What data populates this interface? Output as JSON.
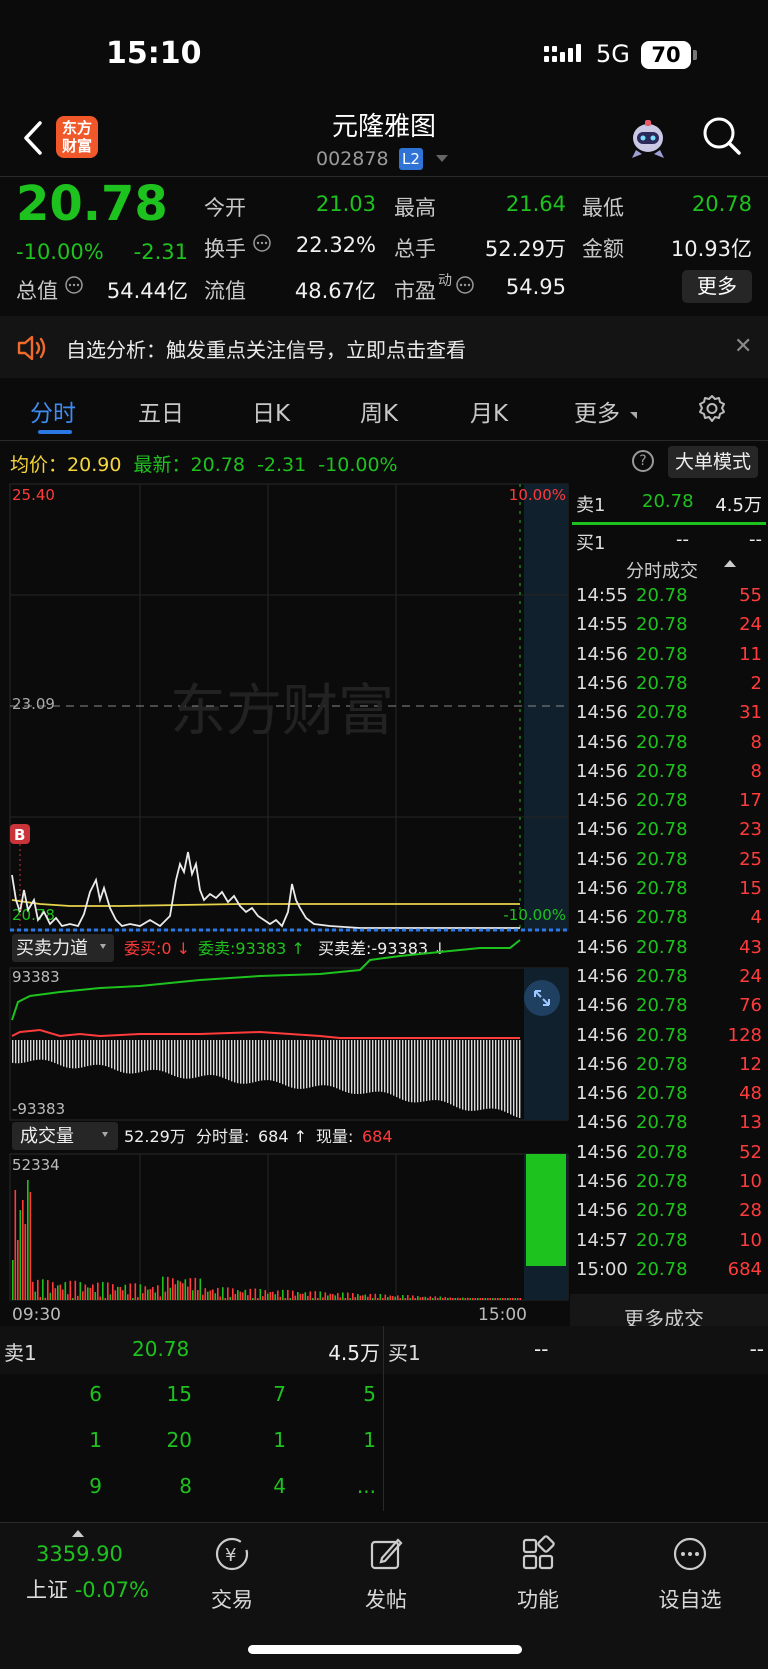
{
  "status": {
    "time": "15:10",
    "network": "5G",
    "battery": "70"
  },
  "nav": {
    "logo": "东方财富",
    "stock_name": "元隆雅图",
    "stock_code": "002878",
    "l2": "L2"
  },
  "quote": {
    "price": "20.78",
    "pct": "-10.00%",
    "change": "-2.31",
    "open_label": "今开",
    "open": "21.03",
    "high_label": "最高",
    "high": "21.64",
    "low_label": "最低",
    "low": "20.78",
    "turnover_label": "换手",
    "turnover": "22.32%",
    "volume_label": "总手",
    "volume": "52.29万",
    "amount_label": "金额",
    "amount": "10.93亿",
    "mcap_label": "总值",
    "mcap": "54.44亿",
    "float_label": "流值",
    "float": "48.67亿",
    "pe_label": "市盈",
    "pe_sup": "动",
    "pe": "54.95",
    "more": "更多"
  },
  "banner": {
    "text": "自选分析：触发重点关注信号，立即点击查看"
  },
  "tabs": [
    "分时",
    "五日",
    "日K",
    "周K",
    "月K",
    "更多"
  ],
  "chart_header": {
    "avg_label": "均价：",
    "avg": "20.90",
    "latest_label": "最新：",
    "latest": "20.78",
    "latest_chg": "-2.31",
    "latest_pct": "-10.00%",
    "big_order": "大单模式"
  },
  "intraday": {
    "watermark": "东方财富",
    "top_price": "25.40",
    "mid_price": "23.09",
    "bottom_price": "20.78",
    "top_pct": "10.00%",
    "bottom_pct": "-10.00%",
    "marker": "B"
  },
  "force": {
    "label": "买卖力道",
    "entrust_buy": "委买:0 ↓",
    "entrust_sell": "委卖:93383 ↑",
    "diff": "买卖差:-93383 ↓",
    "top": "93383",
    "bottom": "-93383"
  },
  "volume": {
    "label": "成交量",
    "total": "52.29万",
    "minute_label": "分时量:",
    "minute": "684 ↑",
    "now_label": "现量:",
    "now": "684",
    "max": "52334",
    "time_start": "09:30",
    "time_end": "15:00"
  },
  "right_panel": {
    "sell1_label": "卖1",
    "sell1_price": "20.78",
    "sell1_vol": "4.5万",
    "buy1_label": "买1",
    "buy1_price": "--",
    "buy1_vol": "--",
    "ticks_title": "分时成交",
    "ticks": [
      {
        "t": "14:55",
        "p": "20.78",
        "v": "55"
      },
      {
        "t": "14:55",
        "p": "20.78",
        "v": "24"
      },
      {
        "t": "14:56",
        "p": "20.78",
        "v": "11"
      },
      {
        "t": "14:56",
        "p": "20.78",
        "v": "2"
      },
      {
        "t": "14:56",
        "p": "20.78",
        "v": "31"
      },
      {
        "t": "14:56",
        "p": "20.78",
        "v": "8"
      },
      {
        "t": "14:56",
        "p": "20.78",
        "v": "8"
      },
      {
        "t": "14:56",
        "p": "20.78",
        "v": "17"
      },
      {
        "t": "14:56",
        "p": "20.78",
        "v": "23"
      },
      {
        "t": "14:56",
        "p": "20.78",
        "v": "25"
      },
      {
        "t": "14:56",
        "p": "20.78",
        "v": "15"
      },
      {
        "t": "14:56",
        "p": "20.78",
        "v": "4"
      },
      {
        "t": "14:56",
        "p": "20.78",
        "v": "43"
      },
      {
        "t": "14:56",
        "p": "20.78",
        "v": "24"
      },
      {
        "t": "14:56",
        "p": "20.78",
        "v": "76"
      },
      {
        "t": "14:56",
        "p": "20.78",
        "v": "128"
      },
      {
        "t": "14:56",
        "p": "20.78",
        "v": "12"
      },
      {
        "t": "14:56",
        "p": "20.78",
        "v": "48"
      },
      {
        "t": "14:56",
        "p": "20.78",
        "v": "13"
      },
      {
        "t": "14:56",
        "p": "20.78",
        "v": "52"
      },
      {
        "t": "14:56",
        "p": "20.78",
        "v": "10"
      },
      {
        "t": "14:56",
        "p": "20.78",
        "v": "28"
      },
      {
        "t": "14:57",
        "p": "20.78",
        "v": "10"
      },
      {
        "t": "15:00",
        "p": "20.78",
        "v": "684"
      }
    ],
    "more_ticks": "更多成交"
  },
  "book": {
    "sell_label": "卖1",
    "sell_price": "20.78",
    "sell_vol": "4.5万",
    "buy_label": "买1",
    "buy_price": "--",
    "buy_vol": "--",
    "queue": [
      [
        "6",
        "15",
        "7",
        "5"
      ],
      [
        "1",
        "20",
        "1",
        "1"
      ],
      [
        "9",
        "8",
        "4",
        "..."
      ]
    ]
  },
  "bottom_nav": {
    "index_value": "3359.90",
    "index_name": "上证",
    "index_pct": "-0.07%",
    "items": [
      "交易",
      "发帖",
      "功能",
      "设自选"
    ]
  }
}
